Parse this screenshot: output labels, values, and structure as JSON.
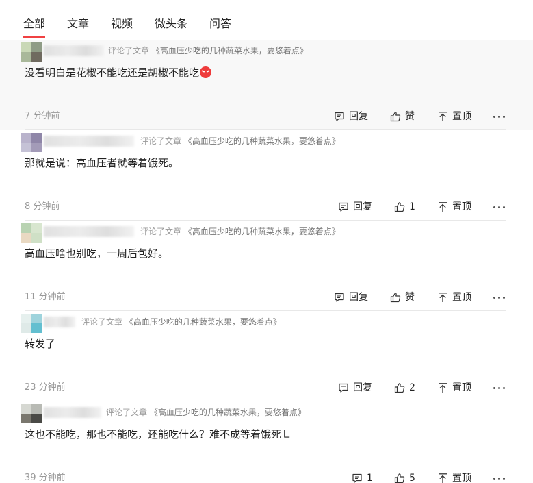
{
  "tabs": [
    {
      "label": "全部",
      "active": true
    },
    {
      "label": "文章",
      "active": false
    },
    {
      "label": "视频",
      "active": false
    },
    {
      "label": "微头条",
      "active": false
    },
    {
      "label": "问答",
      "active": false
    }
  ],
  "accent_color": "#f04142",
  "comments": [
    {
      "source_prefix": "评论了文章",
      "source_title": "《高血压少吃的几种蔬菜水果，要悠着点》",
      "text": "没看明白是花椒不能吃还是胡椒不能吃",
      "emoji": "angry-face-icon",
      "time": "7 分钟前",
      "reply_label": "回复",
      "like_label": "赞",
      "pin_label": "置顶"
    },
    {
      "source_prefix": "评论了文章",
      "source_title": "《高血压少吃的几种蔬菜水果，要悠着点》",
      "text": "那就是说：高血压者就等着饿死。",
      "time": "8 分钟前",
      "reply_label": "回复",
      "like_label": "1",
      "pin_label": "置顶"
    },
    {
      "source_prefix": "评论了文章",
      "source_title": "《高血压少吃的几种蔬菜水果，要悠着点》",
      "text": "高血压啥也别吃，一周后包好。",
      "time": "11 分钟前",
      "reply_label": "回复",
      "like_label": "赞",
      "pin_label": "置顶"
    },
    {
      "source_prefix": "评论了文章",
      "source_title": "《高血压少吃的几种蔬菜水果，要悠着点》",
      "text": "转发了",
      "time": "23 分钟前",
      "reply_label": "回复",
      "like_label": "2",
      "pin_label": "置顶"
    },
    {
      "source_prefix": "评论了文章",
      "source_title": "《高血压少吃的几种蔬菜水果，要悠着点》",
      "text": "这也不能吃，那也不能吃，还能吃什么？难不成等着饿死㇗",
      "time": "39 分钟前",
      "reply_label": "1",
      "like_label": "5",
      "pin_label": "置顶"
    }
  ]
}
